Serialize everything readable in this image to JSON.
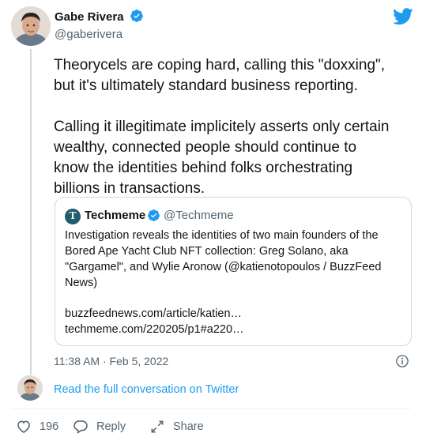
{
  "author": {
    "name": "Gabe Rivera",
    "handle": "@gaberivera"
  },
  "tweet": {
    "paragraphs": [
      "Theorycels are coping hard, calling this \"doxxing\",\nbut it's ultimately standard business reporting.",
      "Calling it illegitimate implicitely asserts only certain\nwealthy, connected people should continue to\nknow the identities behind folks orchestrating\nbillions in transactions."
    ]
  },
  "quote": {
    "avatar_letter": "T",
    "name": "Techmeme",
    "handle": "@Techmeme",
    "text": "Investigation reveals the identities of two main founders of the Bored Ape Yacht Club NFT collection: Greg Solano, aka \"Gargamel\", and Wylie Aronow (@katienotopoulos / BuzzFeed News)",
    "link1": "buzzfeednews.com/article/katien…",
    "link2": "techmeme.com/220205/p1#a220…"
  },
  "timestamp": "11:38 AM · Feb 5, 2022",
  "read_more": "Read the full conversation on Twitter",
  "actions": {
    "like_count": "196",
    "reply_label": "Reply",
    "share_label": "Share"
  },
  "colors": {
    "twitter_blue": "#1d9bf0",
    "text": "#0f1419",
    "secondary": "#536471",
    "border": "#cfd9de"
  },
  "icons": [
    "twitter-bird-icon",
    "verified-badge-icon",
    "info-icon",
    "heart-icon",
    "reply-icon",
    "share-icon"
  ]
}
